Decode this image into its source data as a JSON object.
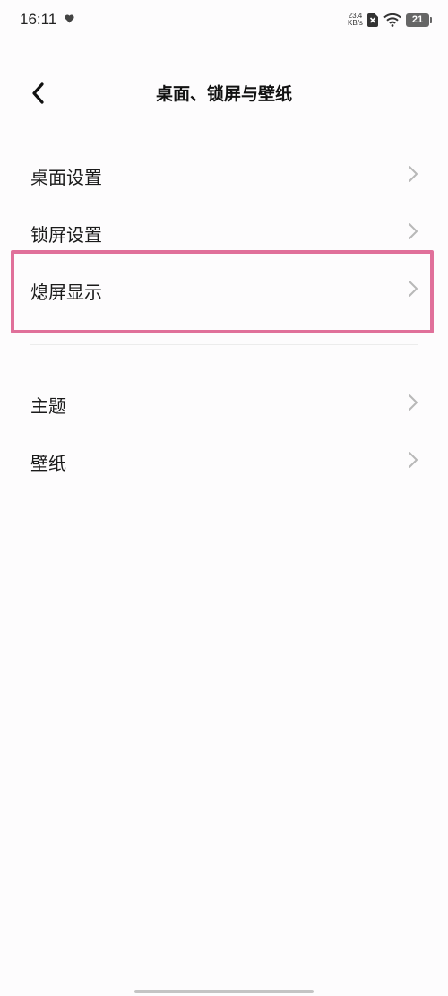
{
  "status_bar": {
    "time": "16:11",
    "net_speed_value": "23.4",
    "net_speed_unit": "KB/s",
    "battery_level": "21",
    "icons": [
      "heart-icon",
      "sim-icon",
      "wifi-icon",
      "battery-icon"
    ]
  },
  "header": {
    "title": "桌面、锁屏与壁纸",
    "back_icon": "chevron-left-icon"
  },
  "groups": [
    {
      "items": [
        {
          "label": "桌面设置"
        },
        {
          "label": "锁屏设置"
        },
        {
          "label": "熄屏显示",
          "highlighted": true
        }
      ]
    },
    {
      "items": [
        {
          "label": "主题"
        },
        {
          "label": "壁纸"
        }
      ]
    }
  ],
  "colors": {
    "highlight": "#e0709a",
    "background": "#fdfcfd",
    "chevron": "#b8b8b8"
  }
}
